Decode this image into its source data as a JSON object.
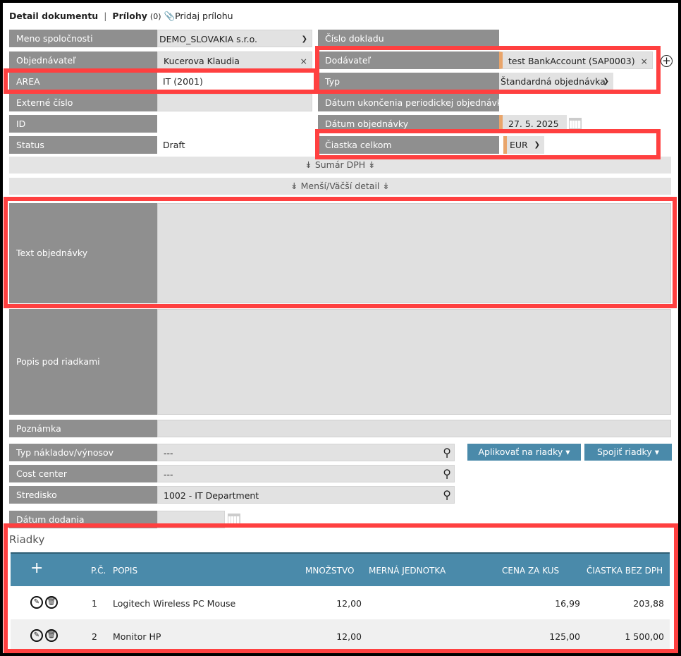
{
  "header": {
    "title": "Detail dokumentu",
    "separator": "|",
    "attachments_label": "Prílohy",
    "attachments_count": "(0)",
    "add_attachment": "Pridaj prílohu"
  },
  "left": {
    "company_label": "Meno spoločnosti",
    "company_value": "DEMO_SLOVAKIA s.r.o.",
    "orderer_label": "Objednávateľ",
    "orderer_value": "Kucerova Klaudia",
    "area_label": "AREA",
    "area_value": "IT (2001)",
    "external_label": "Externé číslo",
    "id_label": "ID",
    "status_label": "Status",
    "status_value": "Draft"
  },
  "right": {
    "doc_number_label": "Číslo dokladu",
    "supplier_label": "Dodávateľ",
    "supplier_value": "test BankAccount (SAP0003)",
    "type_label": "Typ",
    "type_value": "Štandardná objednávka",
    "end_date_label": "Dátum ukončenia periodickej objednávky",
    "order_date_label": "Dátum objednávky",
    "order_date_value": "27. 5. 2025",
    "total_label": "Čiastka celkom",
    "currency_value": "EUR"
  },
  "toggles": {
    "vat_summary": "Sumár DPH",
    "detail_size": "Menší/Väčší detail"
  },
  "texts": {
    "order_text_label": "Text objednávky",
    "below_lines_label": "Popis pod riadkami",
    "note_label": "Poznámka"
  },
  "cost": {
    "cost_type_label": "Typ nákladov/výnosov",
    "cost_type_value": "---",
    "cost_center_label": "Cost center",
    "cost_center_value": "---",
    "department_label": "Stredisko",
    "department_value": "1002 - IT Department",
    "delivery_date_label": "Dátum dodania",
    "apply_button": "Aplikovať na riadky ▾",
    "merge_button": "Spojiť riadky ▾"
  },
  "lines": {
    "title": "Riadky",
    "add": "+",
    "columns": [
      "P.Č.",
      "POPIS",
      "MNOŽSTVO",
      "MERNÁ JEDNOTKA",
      "CENA ZA KUS",
      "ČIASTKA BEZ DPH"
    ],
    "rows": [
      {
        "no": "1",
        "desc": "Logitech Wireless PC Mouse",
        "qty": "12,00",
        "unit": "",
        "price": "16,99",
        "amount": "203,88"
      },
      {
        "no": "2",
        "desc": "Monitor HP",
        "qty": "12,00",
        "unit": "",
        "price": "125,00",
        "amount": "1 500,00"
      }
    ]
  },
  "colors": {
    "label_bg": "#8f8f8f",
    "accent": "#4a8aaa",
    "required": "#e9a56b",
    "highlight": "#ff4040"
  }
}
